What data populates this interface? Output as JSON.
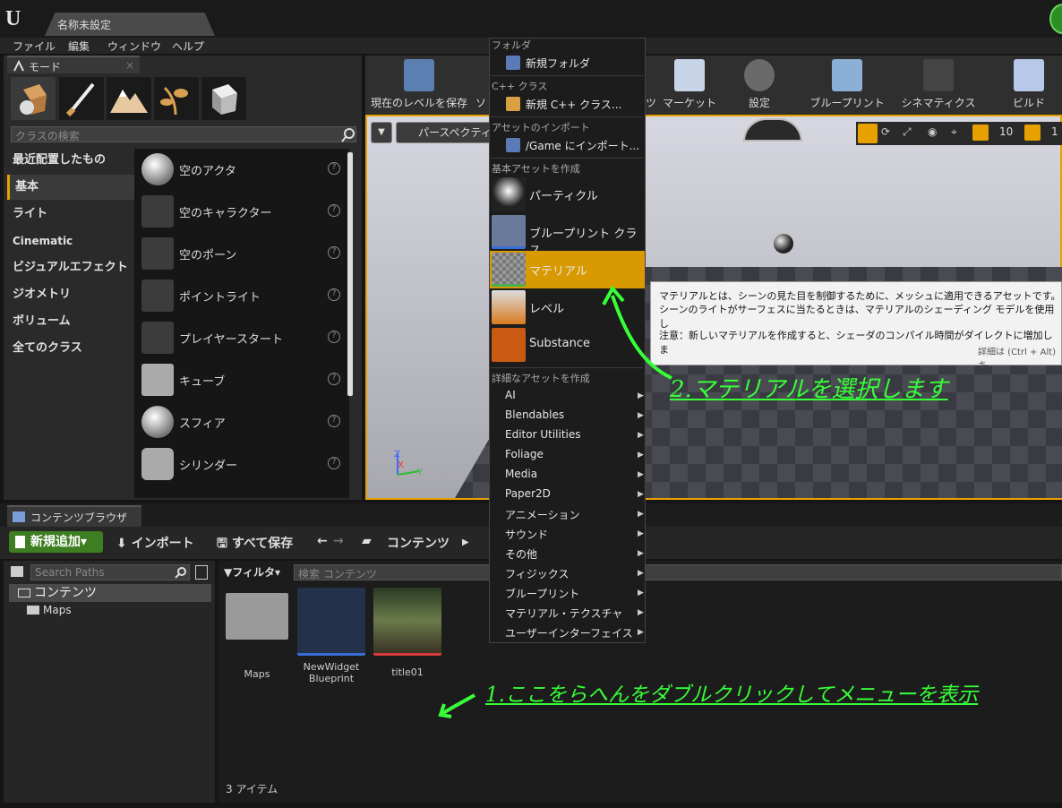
{
  "window": {
    "tab_title": "名称未設定"
  },
  "menubar": [
    "ファイル",
    "編集",
    "ウィンドウ",
    "ヘルプ"
  ],
  "modes_panel": {
    "tab_label": "モード",
    "search_placeholder": "クラスの検索",
    "categories": [
      "最近配置したもの",
      "基本",
      "ライト",
      "Cinematic",
      "ビジュアルエフェクト",
      "ジオメトリ",
      "ボリューム",
      "全てのクラス"
    ],
    "selected_category": "基本",
    "classes": [
      "空のアクタ",
      "空のキャラクター",
      "空のポーン",
      "ポイントライト",
      "プレイヤースタート",
      "キューブ",
      "スフィア",
      "シリンダー"
    ]
  },
  "toolbar": {
    "items": [
      "現在のレベルを保存",
      "ソ",
      "ツ",
      "マーケット",
      "設定",
      "ブループリント",
      "シネマティクス",
      "ビルド"
    ]
  },
  "viewport": {
    "perspective_label": "パースペクティ",
    "grid_snap": "10",
    "rot_snap": "1"
  },
  "content_browser": {
    "tab_label": "コンテンツブラウザ",
    "add_new": "新規追加",
    "import": "インポート",
    "save_all": "すべて保存",
    "path_root": "コンテンツ",
    "search_paths_placeholder": "Search Paths",
    "filter_label": "フィルタ",
    "search_placeholder": "検索 コンテンツ",
    "tree": {
      "root": "コンテンツ",
      "children": [
        "Maps"
      ]
    },
    "assets": [
      {
        "label": "Maps"
      },
      {
        "label": "NewWidget Blueprint"
      },
      {
        "label": "title01"
      }
    ],
    "item_count": "3 アイテム"
  },
  "context_menu": {
    "sections": {
      "folder": "フォルダ",
      "cpp": "C++ クラス",
      "import": "アセットのインポート",
      "basic": "基本アセットを作成",
      "advanced": "詳細なアセットを作成"
    },
    "new_folder": "新規フォルダ",
    "new_cpp": "新規 C++ クラス...",
    "import_to": "/Game にインポート...",
    "basic_assets": [
      "パーティクル",
      "ブループリント クラス",
      "マテリアル",
      "レベル",
      "Substance"
    ],
    "highlighted": "マテリアル",
    "advanced_assets": [
      "AI",
      "Blendables",
      "Editor Utilities",
      "Foliage",
      "Media",
      "Paper2D",
      "アニメーション",
      "サウンド",
      "その他",
      "フィジックス",
      "ブループリント",
      "マテリアル・テクスチャ",
      "ユーザーインターフェイス"
    ]
  },
  "tooltip": {
    "line1": "マテリアルとは、シーンの見た目を制御するために、メッシュに適用できるアセットです。",
    "line2": "シーンのライトがサーフェスに当たるときは、マテリアルのシェーディング モデルを使用し",
    "line3": "注意：新しいマテリアルを作成すると、シェーダのコンパイル時間がダイレクトに増加しま",
    "line4": "詳細は (Ctrl + Alt) キ"
  },
  "annotations": {
    "step1": "1.ここをらへんをダブルクリックしてメニューを表示",
    "step2": "2.マテリアルを選択します"
  },
  "colors": {
    "accent": "#e6a000",
    "highlight": "#d89a00",
    "annotation": "#37ff37",
    "add_button": "#3e7e22"
  }
}
